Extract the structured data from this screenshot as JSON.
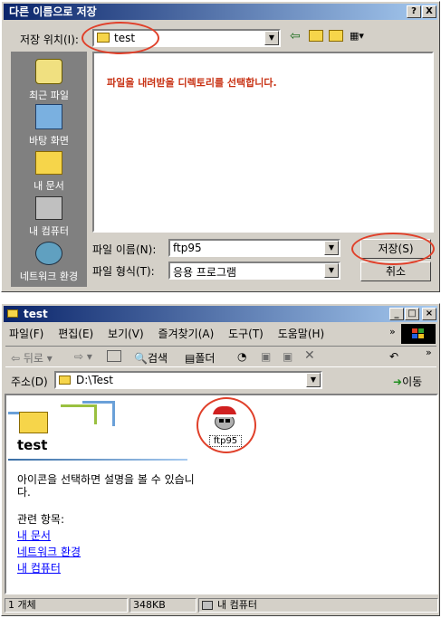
{
  "save_dialog": {
    "title": "다른 이름으로 저장",
    "title_help": "?",
    "title_close": "X",
    "location_label": "저장 위치(I):",
    "location_value": "test",
    "message": "파일을 내려받을 디렉토리를 선택합니다.",
    "places": [
      {
        "label": "최근 파일",
        "icon": "recent-files-icon"
      },
      {
        "label": "바탕 화면",
        "icon": "desktop-icon"
      },
      {
        "label": "내 문서",
        "icon": "my-documents-icon"
      },
      {
        "label": "내 컴퓨터",
        "icon": "my-computer-icon"
      },
      {
        "label": "네트워크 환경",
        "icon": "network-icon"
      }
    ],
    "filename_label": "파일 이름(N):",
    "filename_value": "ftp95",
    "filetype_label": "파일 형식(T):",
    "filetype_value": "응용 프로그램",
    "save_button": "저장(S)",
    "cancel_button": "취소"
  },
  "explorer": {
    "title": "test",
    "menu": [
      "파일(F)",
      "편집(E)",
      "보기(V)",
      "즐겨찾기(A)",
      "도구(T)",
      "도움말(H)"
    ],
    "toolbar": {
      "back": "뒤로",
      "search": "검색",
      "folders": "폴더"
    },
    "address_label": "주소(D)",
    "address_value": "D:\\Test",
    "go_label": "이동",
    "folder_title": "test",
    "description": "아이콘을 선택하면 설명을 볼 수 있습니다.",
    "related_label": "관련 항목:",
    "related_links": [
      "내 문서",
      "네트워크 환경",
      "내 컴퓨터"
    ],
    "file_item": "ftp95",
    "status": {
      "objects": "1 개체",
      "size": "348KB",
      "location": "내 컴퓨터"
    }
  },
  "colors": {
    "accent_ring": "#e0402a",
    "titlebar": "#0a246a",
    "message": "#c83214"
  }
}
